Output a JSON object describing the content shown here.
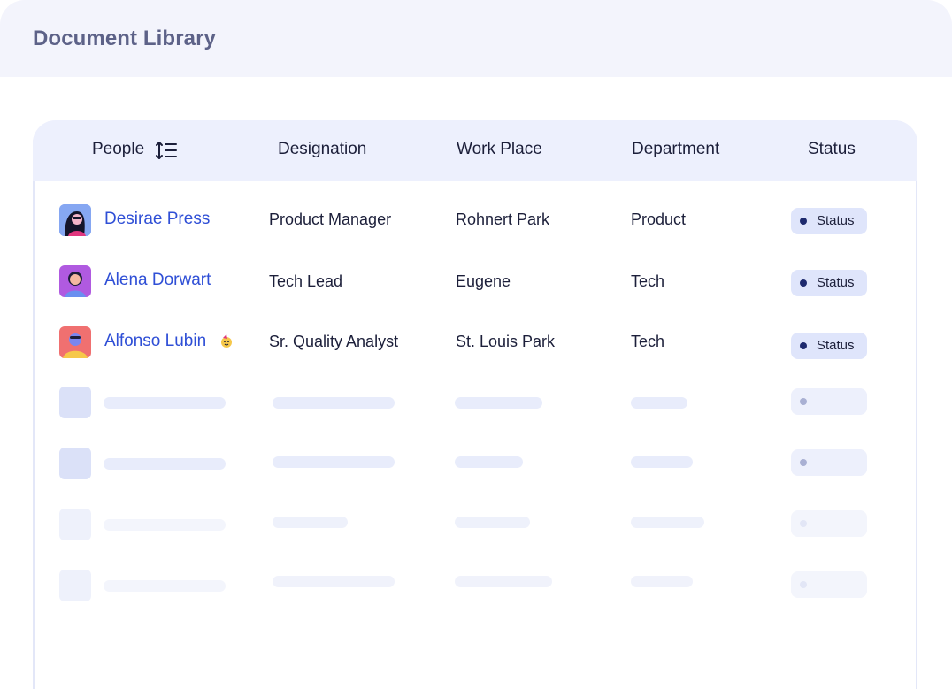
{
  "page": {
    "title": "Document Library"
  },
  "table": {
    "columns": [
      "People",
      "Designation",
      "Work Place",
      "Department",
      "Status"
    ],
    "rows": [
      {
        "name": "Desirae Press",
        "designation": "Product Manager",
        "work_place": "Rohnert Park",
        "department": "Product",
        "status": "Status",
        "avatar": "avatar-woman-dark-hair-icon"
      },
      {
        "name": "Alena Dorwart",
        "designation": "Tech Lead",
        "work_place": "Eugene",
        "department": "Tech",
        "status": "Status",
        "avatar": "avatar-woman-purple-icon"
      },
      {
        "name": "Alfonso Lubin",
        "designation": "Sr. Quality Analyst",
        "work_place": "St. Louis Park",
        "department": "Tech",
        "status": "Status",
        "avatar": "avatar-man-yellow-icon",
        "badge_emoji": "party-face-icon"
      }
    ],
    "placeholder_rows": 4
  },
  "colors": {
    "accent_link": "#2f4fd6",
    "header_bg": "#edf0fd",
    "status_bg": "#dfe5fb",
    "status_dot": "#1e2a6e"
  }
}
